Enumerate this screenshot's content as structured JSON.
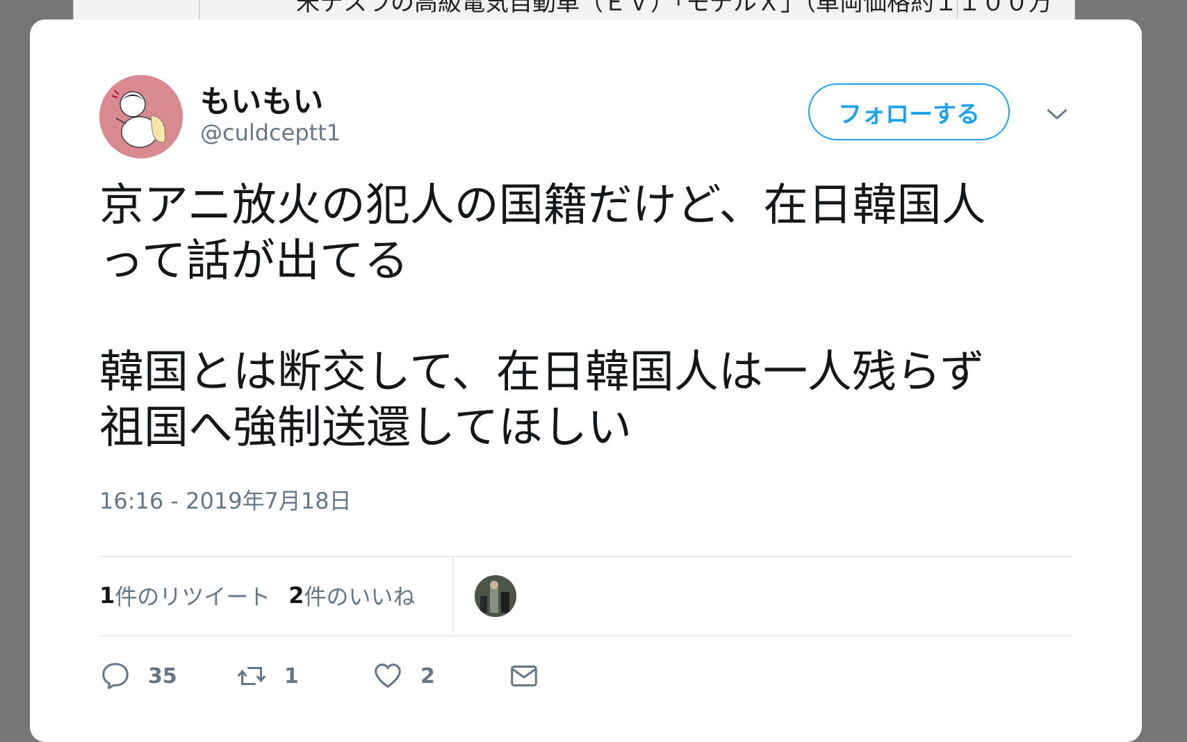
{
  "background": {
    "snippet": "米テスラの高級電気自動車（ＥＶ）「モデルＸ」（車両価格約１１００万"
  },
  "tweet": {
    "display_name": "もいもい",
    "handle": "@culdceptt1",
    "follow_label": "フォローする",
    "text": "京アニ放火の犯人の国籍だけど、在日韓国人\nって話が出てる\n\n韓国とは断交して、在日韓国人は一人残らず\n祖国へ強制送還してほしい",
    "timestamp": "16:16 - 2019年7月18日",
    "stats": {
      "retweets_num": "1",
      "retweets_label": "件のリツイート",
      "likes_num": "2",
      "likes_label": "件のいいね"
    },
    "actions": {
      "reply_count": "35",
      "retweet_count": "1",
      "like_count": "2"
    }
  },
  "colors": {
    "accent": "#1da1f2",
    "text": "#14171a",
    "secondary": "#657786",
    "divider": "#e6ecf0",
    "avatar_bg": "#d98a91"
  },
  "icons": [
    "avatar",
    "chevron-down-icon",
    "reply-icon",
    "retweet-icon",
    "heart-icon",
    "mail-icon"
  ]
}
